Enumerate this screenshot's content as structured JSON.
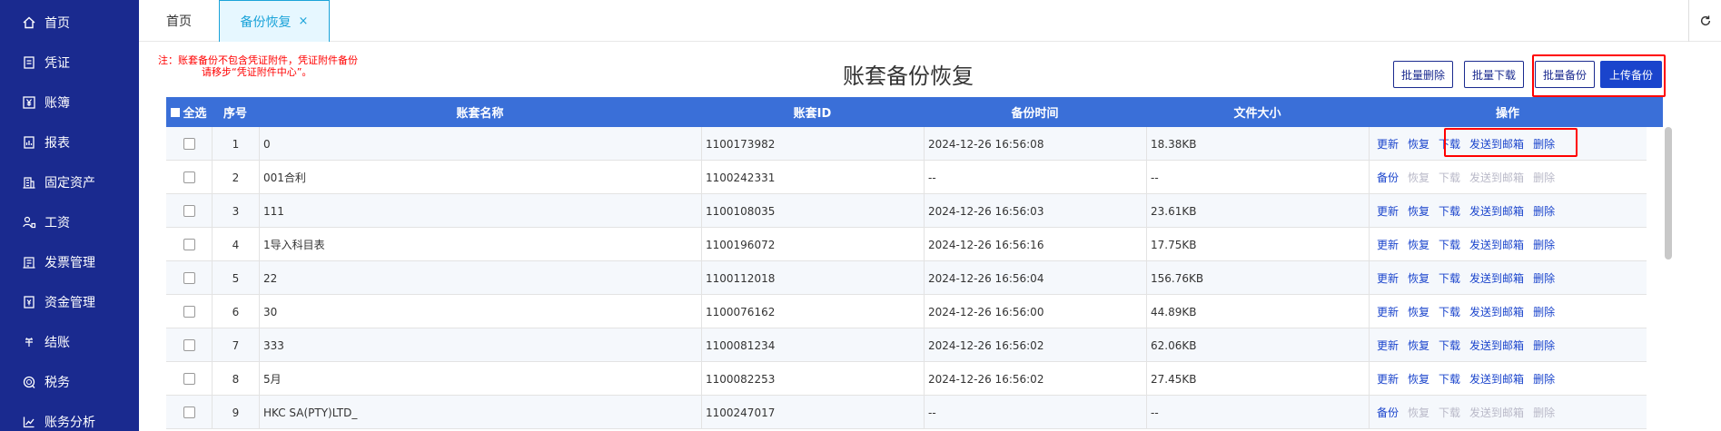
{
  "sidebar": {
    "items": [
      {
        "label": "首页",
        "icon": "home-icon"
      },
      {
        "label": "凭证",
        "icon": "voucher-icon"
      },
      {
        "label": "账簿",
        "icon": "yen-icon"
      },
      {
        "label": "报表",
        "icon": "report-icon"
      },
      {
        "label": "固定资产",
        "icon": "building-icon"
      },
      {
        "label": "工资",
        "icon": "salary-icon"
      },
      {
        "label": "发票管理",
        "icon": "invoice-icon"
      },
      {
        "label": "资金管理",
        "icon": "fund-icon"
      },
      {
        "label": "结账",
        "icon": "settle-icon"
      },
      {
        "label": "税务",
        "icon": "tax-icon"
      },
      {
        "label": "账务分析",
        "icon": "analysis-icon"
      }
    ]
  },
  "tabs": {
    "home": "首页",
    "active": "备份恢复",
    "close": "×"
  },
  "notice": {
    "line1": "注：账套备份不包含凭证附件，凭证附件备份",
    "line2": "请移步“凭证附件中心”。"
  },
  "page_title": "账套备份恢复",
  "toolbar": {
    "batch_delete": "批量删除",
    "batch_download": "批量下载",
    "batch_backup": "批量备份",
    "upload_backup": "上传备份"
  },
  "table": {
    "columns": {
      "select_all": "全选",
      "index": "序号",
      "name": "账套名称",
      "id": "账套ID",
      "time": "备份时间",
      "size": "文件大小",
      "ops": "操作"
    },
    "rows": [
      {
        "index": "1",
        "name": "0",
        "id": "1100173982",
        "time": "2024-12-26 16:56:08",
        "size": "18.38KB",
        "has_backup": true
      },
      {
        "index": "2",
        "name": "001合利",
        "id": "1100242331",
        "time": "--",
        "size": "--",
        "has_backup": false
      },
      {
        "index": "3",
        "name": "111",
        "id": "1100108035",
        "time": "2024-12-26 16:56:03",
        "size": "23.61KB",
        "has_backup": true
      },
      {
        "index": "4",
        "name": "1导入科目表",
        "id": "1100196072",
        "time": "2024-12-26 16:56:16",
        "size": "17.75KB",
        "has_backup": true
      },
      {
        "index": "5",
        "name": "22",
        "id": "1100112018",
        "time": "2024-12-26 16:56:04",
        "size": "156.76KB",
        "has_backup": true
      },
      {
        "index": "6",
        "name": "30",
        "id": "1100076162",
        "time": "2024-12-26 16:56:00",
        "size": "44.89KB",
        "has_backup": true
      },
      {
        "index": "7",
        "name": "333",
        "id": "1100081234",
        "time": "2024-12-26 16:56:02",
        "size": "62.06KB",
        "has_backup": true
      },
      {
        "index": "8",
        "name": "5月",
        "id": "1100082253",
        "time": "2024-12-26 16:56:02",
        "size": "27.45KB",
        "has_backup": true
      },
      {
        "index": "9",
        "name": "HKC SA(PTY)LTD_",
        "id": "1100247017",
        "time": "--",
        "size": "--",
        "has_backup": false
      }
    ],
    "actions_with_backup": [
      "更新",
      "恢复",
      "下载",
      "发送到邮箱",
      "删除"
    ],
    "actions_no_backup": [
      "备份",
      "恢复",
      "下载",
      "发送到邮箱",
      "删除"
    ]
  },
  "colors": {
    "sidebar_bg": "#1a2a8f",
    "header_bg": "#3a6fd8",
    "accent": "#1a44cc",
    "highlight": "#ff0000"
  }
}
